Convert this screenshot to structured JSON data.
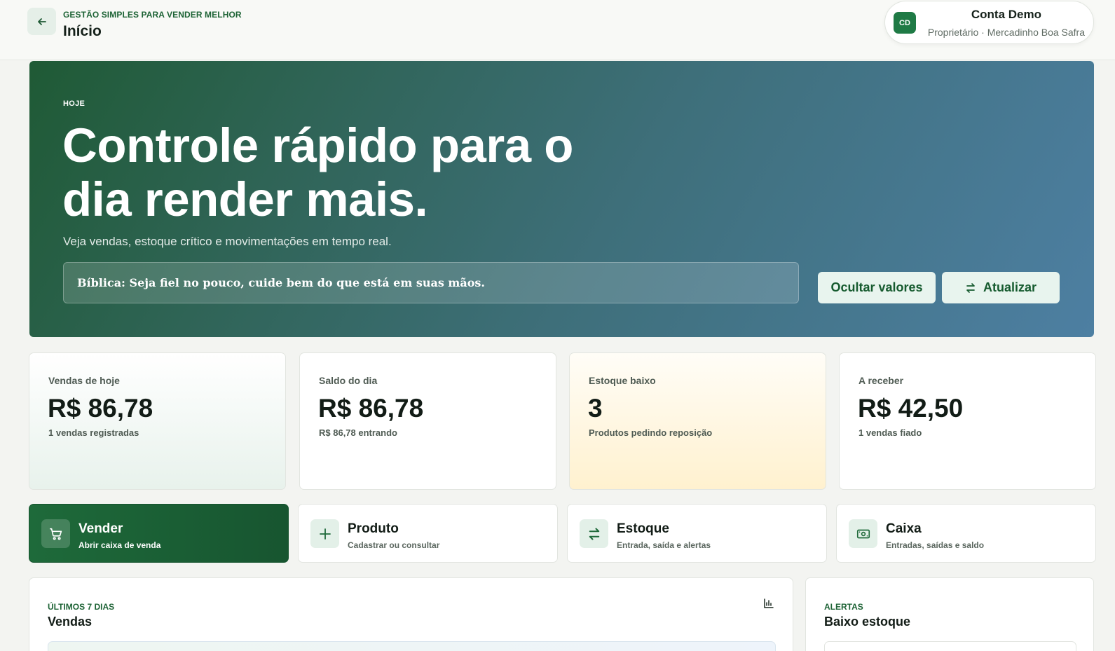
{
  "header": {
    "eyebrow": "GESTÃO SIMPLES PARA VENDER MELHOR",
    "title": "Início",
    "account": {
      "initials": "CD",
      "name": "Conta Demo",
      "role": "Proprietário · Mercadinho Boa Safra"
    }
  },
  "hero": {
    "eyebrow": "HOJE",
    "title": "Controle rápido para o dia render mais.",
    "subtitle": "Veja vendas, estoque crítico e movimentações em tempo real.",
    "verse": "Bíblica: Seja fiel no pouco, cuide bem do que está em suas mãos.",
    "hide_button": "Ocultar valores",
    "refresh_button": "Atualizar"
  },
  "stats": [
    {
      "label": "Vendas de hoje",
      "value": "R$ 86,78",
      "note": "1 vendas registradas"
    },
    {
      "label": "Saldo do dia",
      "value": "R$ 86,78",
      "note": "R$ 86,78 entrando"
    },
    {
      "label": "Estoque baixo",
      "value": "3",
      "note": "Produtos pedindo reposição"
    },
    {
      "label": "A receber",
      "value": "R$ 42,50",
      "note": "1 vendas fiado"
    }
  ],
  "actions": [
    {
      "title": "Vender",
      "subtitle": "Abrir caixa de venda",
      "icon": "cart-icon"
    },
    {
      "title": "Produto",
      "subtitle": "Cadastrar ou consultar",
      "icon": "plus-icon"
    },
    {
      "title": "Estoque",
      "subtitle": "Entrada, saída e alertas",
      "icon": "swap-icon"
    },
    {
      "title": "Caixa",
      "subtitle": "Entradas, saídas e saldo",
      "icon": "cash-icon"
    }
  ],
  "panels": {
    "sales": {
      "eyebrow": "ÚLTIMOS 7 DIAS",
      "title": "Vendas"
    },
    "alerts": {
      "eyebrow": "ALERTAS",
      "title": "Baixo estoque"
    }
  },
  "colors": {
    "brand": "#1f6a3a",
    "accent_blue": "#4d7fa2",
    "warning_bg": "#fff1cf"
  }
}
